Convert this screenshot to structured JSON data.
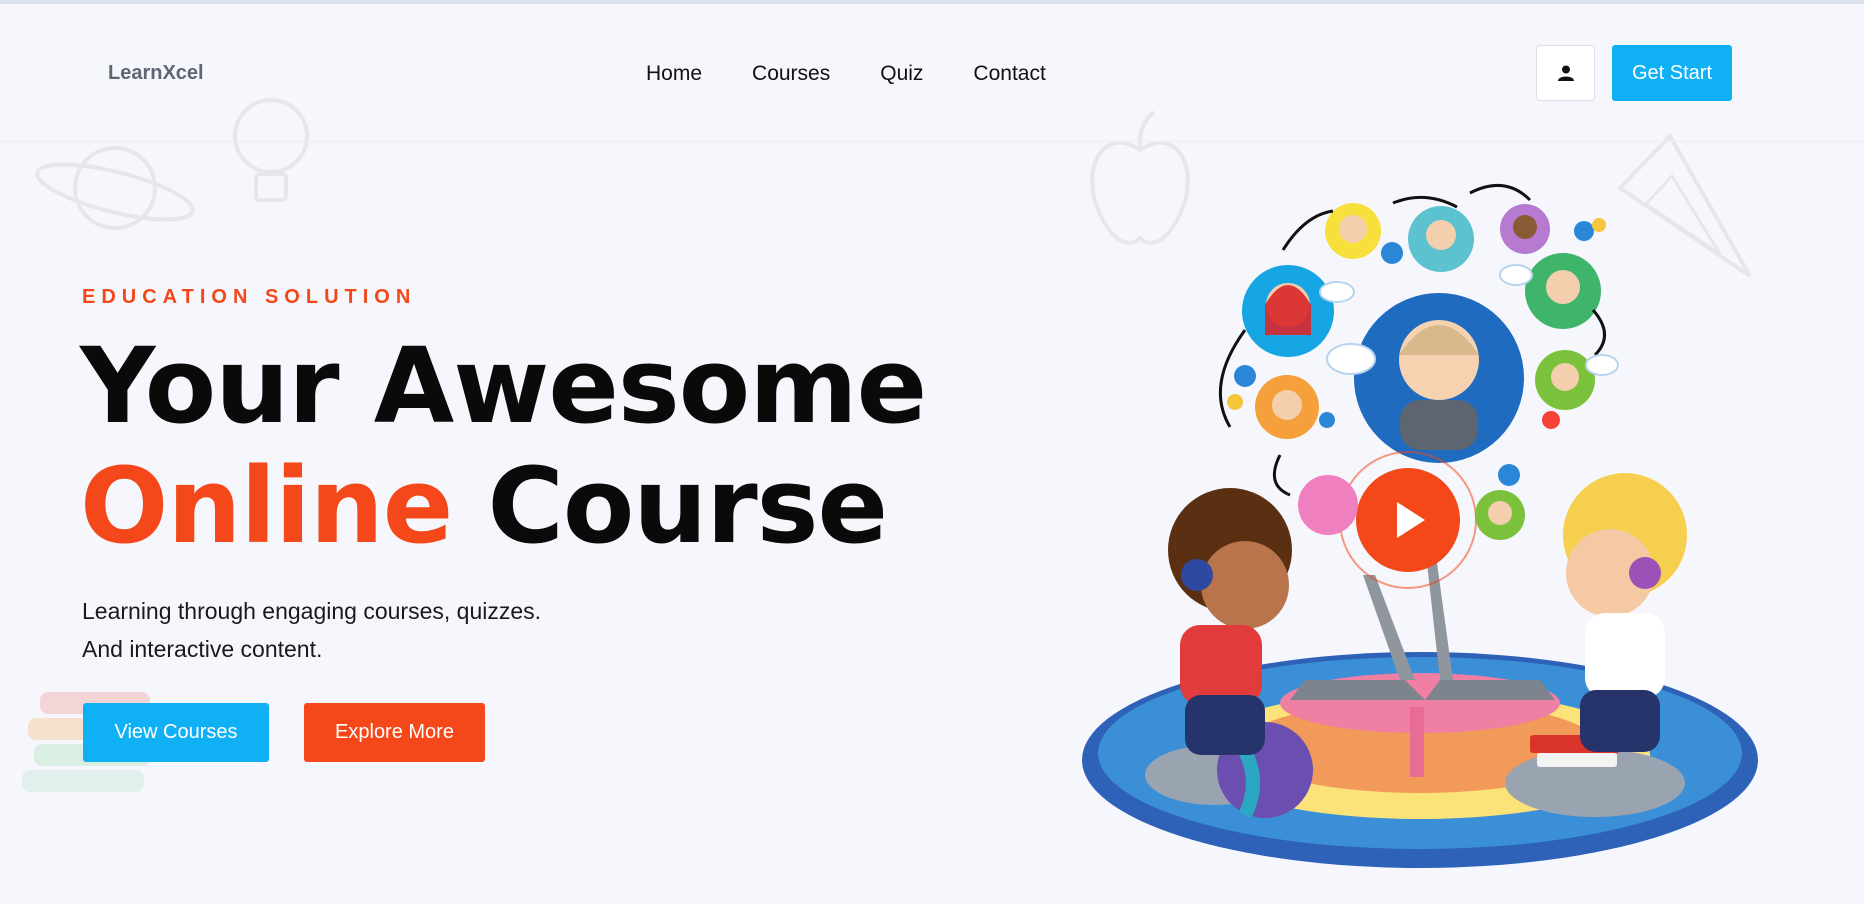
{
  "brand": {
    "name": "LearnXcel"
  },
  "nav": {
    "items": [
      {
        "label": "Home"
      },
      {
        "label": "Courses"
      },
      {
        "label": "Quiz"
      },
      {
        "label": "Contact"
      }
    ]
  },
  "header_actions": {
    "user_icon": "user-icon",
    "get_start_label": "Get Start"
  },
  "hero": {
    "eyebrow": "EDUCATION SOLUTION",
    "headline_line1": "Your Awesome",
    "headline_accent": "Online",
    "headline_rest": " Course",
    "subtitle_line1": "Learning through engaging courses, quizzes.",
    "subtitle_line2": "And interactive content.",
    "primary_button": "View Courses",
    "secondary_button": "Explore More",
    "illustration": "kids-online-learning-illustration"
  },
  "colors": {
    "accent_orange": "#f4471a",
    "accent_blue": "#10b0f5",
    "background": "#f6f7fc"
  }
}
